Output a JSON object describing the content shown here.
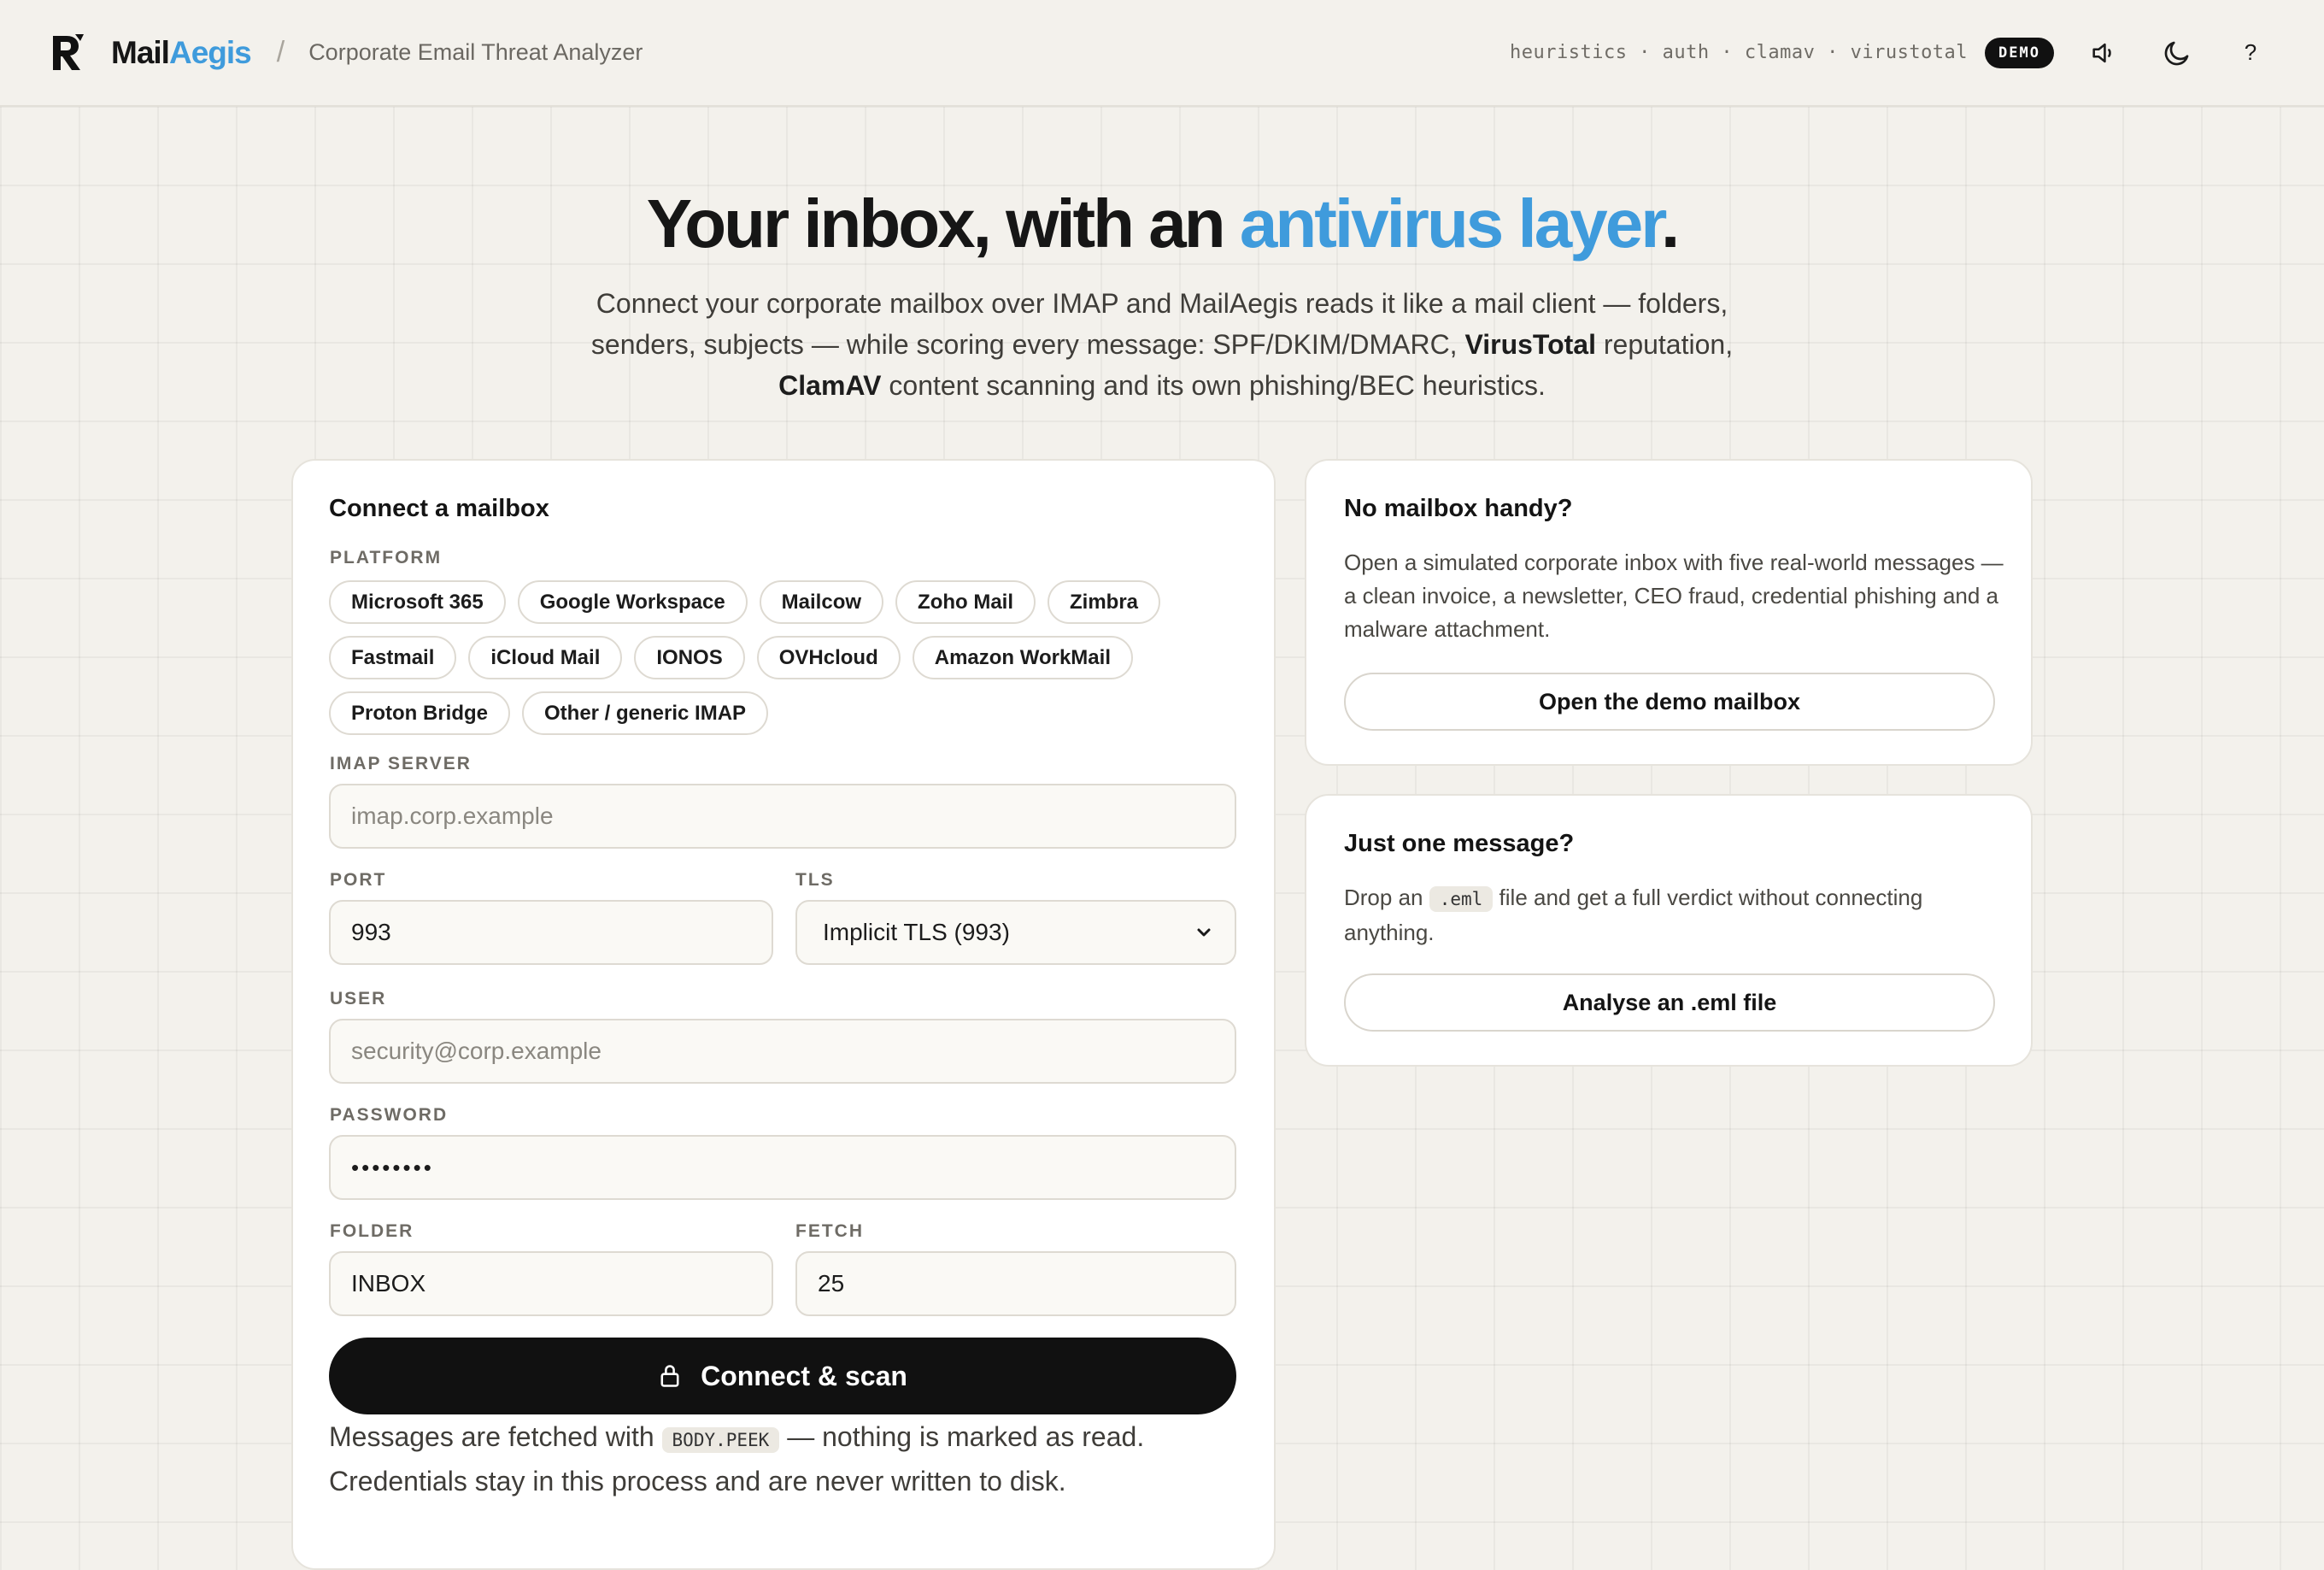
{
  "header": {
    "brand_part1": "Mail",
    "brand_part2": "Aegis",
    "separator": "/",
    "subtitle": "Corporate Email Threat Analyzer",
    "engines": "heuristics · auth · clamav · virustotal",
    "demo_badge": "DEMO",
    "help": "?"
  },
  "hero": {
    "title_part1": "Your inbox, with an ",
    "title_accent": "antivirus layer",
    "title_end": ".",
    "desc_1": "Connect your corporate mailbox over IMAP and MailAegis reads it like a mail client — folders, senders, subjects — while scoring every message: SPF/DKIM/DMARC, ",
    "desc_vt": "VirusTotal",
    "desc_2": " reputation, ",
    "desc_clam": "ClamAV",
    "desc_3": " content scanning and its own phishing/BEC heuristics."
  },
  "connect": {
    "title": "Connect a mailbox",
    "platform_label": "PLATFORM",
    "platforms": [
      "Microsoft 365",
      "Google Workspace",
      "Mailcow",
      "Zoho Mail",
      "Zimbra",
      "Fastmail",
      "iCloud Mail",
      "IONOS",
      "OVHcloud",
      "Amazon WorkMail",
      "Proton Bridge",
      "Other / generic IMAP"
    ],
    "server_label": "IMAP SERVER",
    "server_placeholder": "imap.corp.example",
    "port_label": "PORT",
    "port_value": "993",
    "tls_label": "TLS",
    "tls_value": "Implicit TLS (993)",
    "user_label": "USER",
    "user_placeholder": "security@corp.example",
    "password_label": "PASSWORD",
    "password_value": "••••••••",
    "folder_label": "FOLDER",
    "folder_value": "INBOX",
    "fetch_label": "FETCH",
    "fetch_value": "25",
    "button": "Connect & scan",
    "note_1": "Messages are fetched with ",
    "note_code": "BODY.PEEK",
    "note_2": " — nothing is marked as read.",
    "note_3": "Credentials stay in this process and are never written to disk."
  },
  "demo_card": {
    "title": "No mailbox handy?",
    "desc": "Open a simulated corporate inbox with five real-world messages — a clean invoice, a newsletter, CEO fraud, credential phishing and a malware attachment.",
    "button": "Open the demo mailbox"
  },
  "eml_card": {
    "title": "Just one message?",
    "desc_1": "Drop an ",
    "desc_code": ".eml",
    "desc_2": " file and get a full verdict without connecting anything.",
    "button": "Analyse an .eml file"
  },
  "colors": {
    "accent": "#3f9bdc",
    "background": "#f3f1ec",
    "button_dark": "#111111"
  }
}
